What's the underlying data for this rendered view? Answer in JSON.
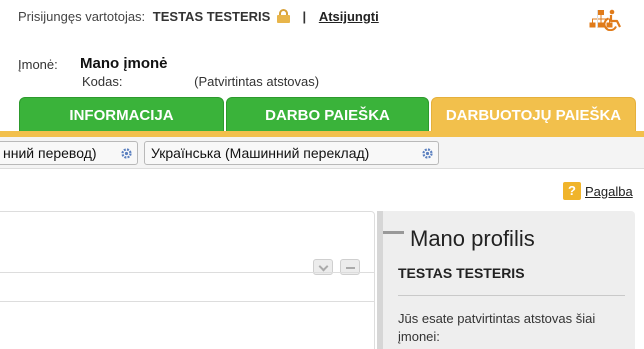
{
  "header": {
    "user_label": "Prisijungęs vartotojas:",
    "user_name": "TESTAS TESTERIS",
    "separator": "|",
    "logout_label": "Atsijungti"
  },
  "company": {
    "label": "Įmonė:",
    "name": "Mano įmonė",
    "code_label": "Kodas:",
    "code_value": "(Patvirtintas atstovas)"
  },
  "tabs": [
    {
      "label": "INFORMACIJA",
      "state": "inactive"
    },
    {
      "label": "DARBO PAIEŠKA",
      "state": "inactive"
    },
    {
      "label": "DARBUOTOJŲ PAIEŠKA",
      "state": "active"
    }
  ],
  "languages": [
    {
      "label": "нний перевод)"
    },
    {
      "label": "Українська (Машинний переклад)"
    }
  ],
  "help": {
    "icon_text": "?",
    "label": "Pagalba"
  },
  "profile": {
    "title": "Mano profilis",
    "name": "TESTAS TESTERIS",
    "description": "Jūs esate patvirtintas atstovas šiai įmonei:"
  },
  "colors": {
    "green_tab": "#3ab33a",
    "orange_tab": "#f2c04c",
    "accent_icons": "#e07b1a"
  },
  "icons": [
    "lock-icon",
    "sitemap-icon",
    "accessibility-icon",
    "gear-icon",
    "help-icon",
    "chevron-down-icon",
    "minus-icon"
  ]
}
